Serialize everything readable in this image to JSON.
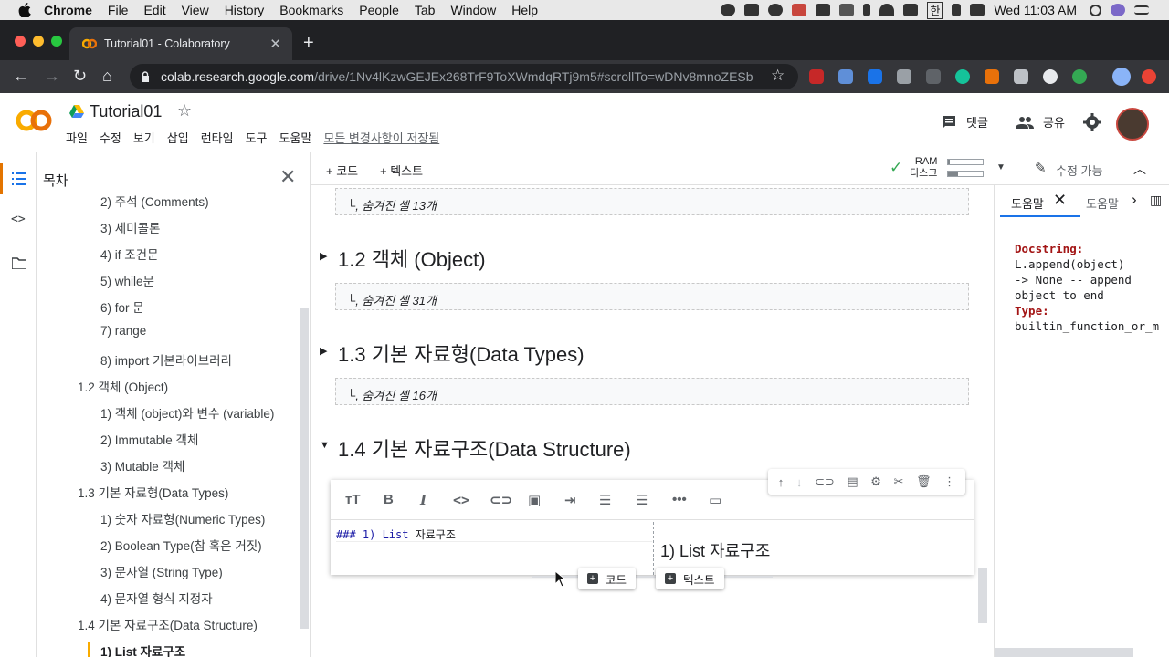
{
  "mac_menubar": {
    "app": "Chrome",
    "items": [
      "File",
      "Edit",
      "View",
      "History",
      "Bookmarks",
      "People",
      "Tab",
      "Window",
      "Help"
    ],
    "clock": "Wed 11:03 AM",
    "input_lang": "한"
  },
  "browser": {
    "tab_title": "Tutorial01 - Colaboratory",
    "url_host": "colab.research.google.com",
    "url_path": "/drive/1Nv4lKzwGEJEx268TrF9ToXWmdqRTj9m5#scrollTo=wDNv8mnoZESb"
  },
  "colab": {
    "notebook_title": "Tutorial01",
    "menu": [
      "파일",
      "수정",
      "보기",
      "삽입",
      "런타임",
      "도구",
      "도움말"
    ],
    "save_status": "모든 변경사항이 저장됨",
    "comment_label": "댓글",
    "share_label": "공유"
  },
  "toc": {
    "title": "목차",
    "items": [
      "2) 주석 (Comments)",
      "3) 세미콜론",
      "4) if 조건문",
      "5) while문",
      "6) for 문",
      "7) range",
      "8) import 기본라이브러리",
      "1.2 객체 (Object)",
      "1) 객체 (object)와 변수 (variable)",
      "2) Immutable 객체",
      "3) Mutable 객체",
      "1.3 기본 자료형(Data Types)",
      "1) 숫자 자료형(Numeric Types)",
      "2) Boolean Type(참 혹은 거짓)",
      "3) 문자열 (String Type)",
      "4) 문자열 형식 지정자",
      "1.4 기본 자료구조(Data Structure)",
      "1) List 자료구조"
    ]
  },
  "nb_toolbar": {
    "add_code": "+ 코드",
    "add_text": "+ 텍스트",
    "ram_label": "RAM",
    "disk_label": "디스크",
    "edit_mode": "수정 가능",
    "ram_usage": 0.06,
    "disk_usage": 0.3
  },
  "notebook": {
    "hidden1": "숨겨진 셀 13개",
    "sec12": "1.2 객체 (Object)",
    "hidden2": "숨겨진 셀 31개",
    "sec13": "1.3 기본 자료형(Data Types)",
    "hidden3": "숨겨진 셀 16개",
    "sec14": "1.4 기본 자료구조(Data Structure)",
    "code_prefix": "### 1) List ",
    "code_text": "자료구조",
    "preview": "1) List 자료구조",
    "add_code": "코드",
    "add_text": "텍스트"
  },
  "help": {
    "tab1": "도움말",
    "tab2": "도움말",
    "docstring_label": "Docstring:",
    "doc_lines": [
      "L.append(object)",
      "-> None -- append",
      "object to end"
    ],
    "type_label": "Type:",
    "type_value": "builtin_function_or_m"
  }
}
